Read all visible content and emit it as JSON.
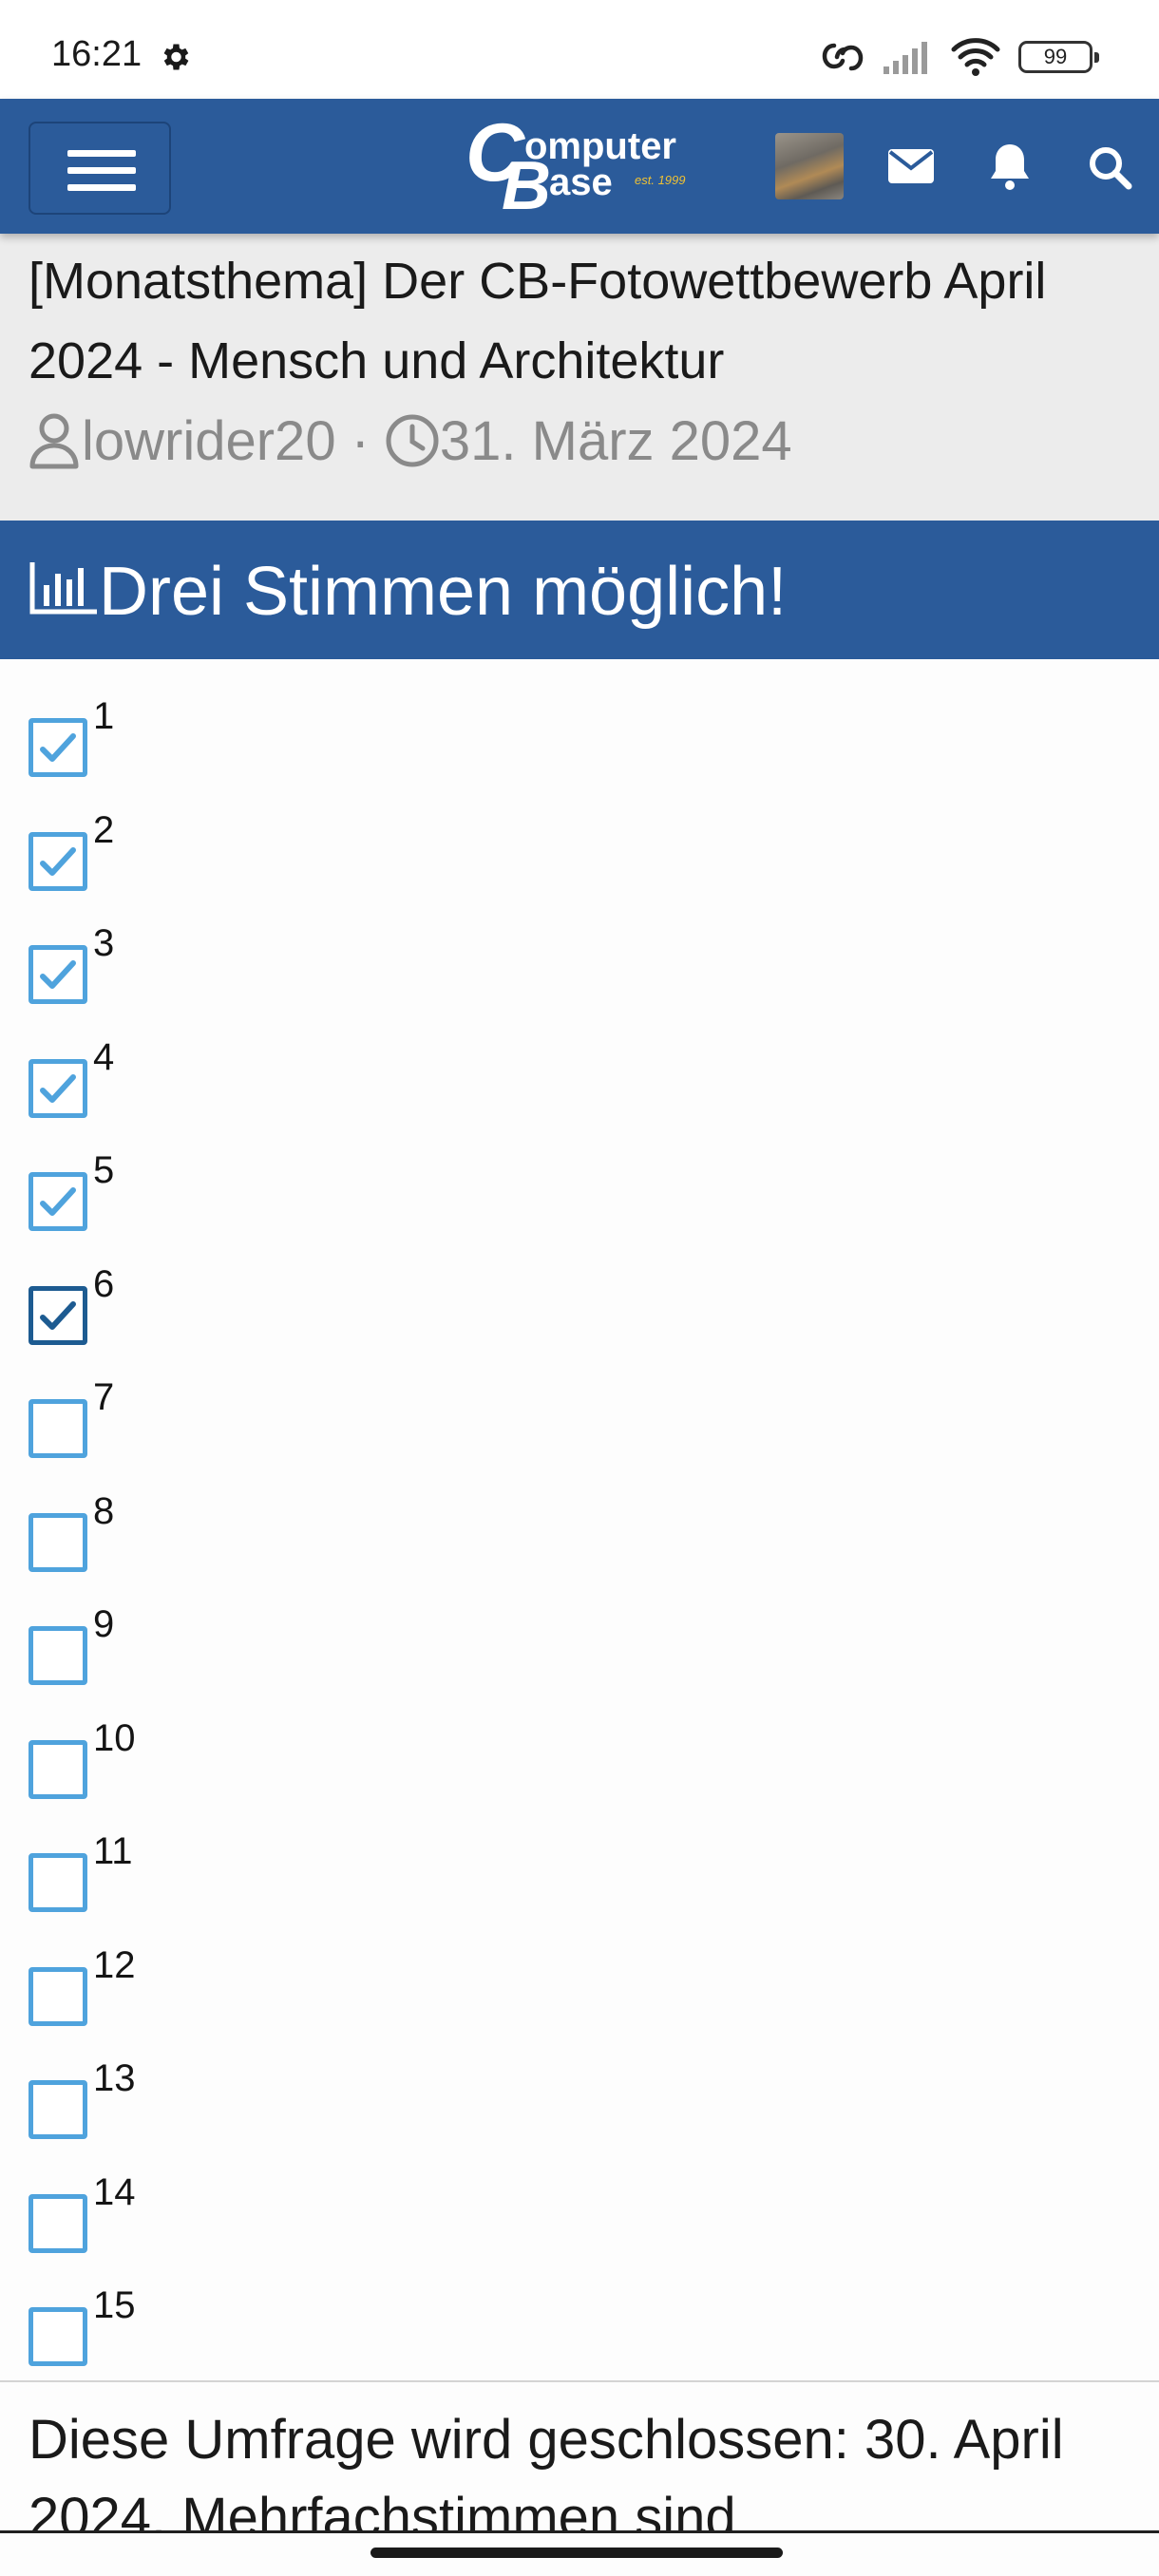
{
  "status_bar": {
    "time": "16:21",
    "battery": "99",
    "icons": [
      "gear-icon",
      "link-icon",
      "signal-icon",
      "wifi-icon",
      "battery-icon"
    ]
  },
  "header": {
    "logo": {
      "computer": "omputer",
      "c": "C",
      "b": "B",
      "ase": "ase",
      "est": "est. 1999"
    },
    "icons": [
      "menu-icon",
      "avatar",
      "mail-icon",
      "bell-icon",
      "search-icon"
    ]
  },
  "thread": {
    "title": "[Monatsthema] Der CB-Fotowettbewerb April 2024 - Mensch und Architektur",
    "author": "lowrider20",
    "separator": "·",
    "date": "31. März 2024"
  },
  "poll": {
    "title": "Drei Stimmen möglich!",
    "options": [
      {
        "label": "1",
        "checked": true
      },
      {
        "label": "2",
        "checked": true
      },
      {
        "label": "3",
        "checked": true
      },
      {
        "label": "4",
        "checked": true
      },
      {
        "label": "5",
        "checked": true
      },
      {
        "label": "6",
        "checked": true
      },
      {
        "label": "7",
        "checked": false
      },
      {
        "label": "8",
        "checked": false
      },
      {
        "label": "9",
        "checked": false
      },
      {
        "label": "10",
        "checked": false
      },
      {
        "label": "11",
        "checked": false
      },
      {
        "label": "12",
        "checked": false
      },
      {
        "label": "13",
        "checked": false
      },
      {
        "label": "14",
        "checked": false
      },
      {
        "label": "15",
        "checked": false
      }
    ],
    "footer": "Diese Umfrage wird geschlossen: 30. April 2024. Mehrfachstimmen sind"
  },
  "colors": {
    "header_blue": "#2b5b9a",
    "checkbox_blue": "#4fa3dd",
    "checkbox_focus": "#1d5b91",
    "meta_gray": "#8a8a8a"
  }
}
